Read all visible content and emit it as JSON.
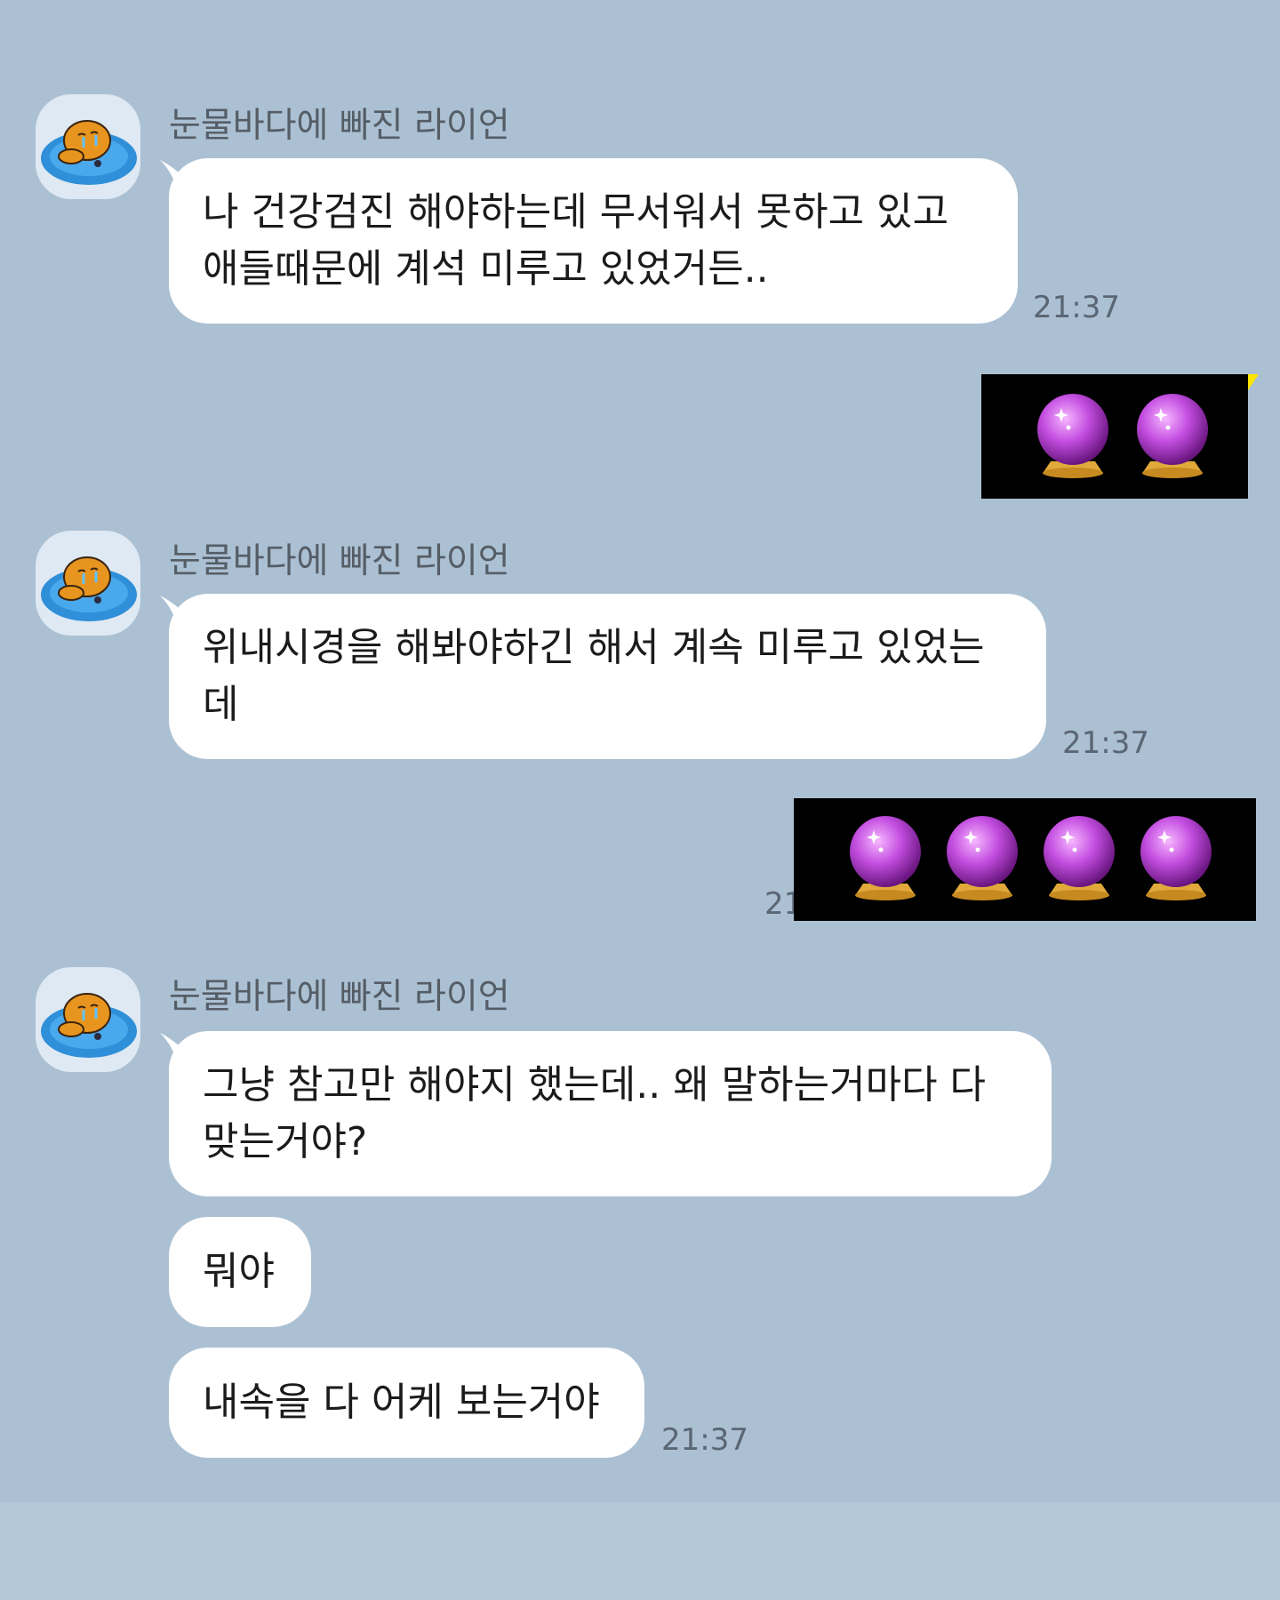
{
  "sender": {
    "name": "눈물바다에 빠진 라이언"
  },
  "messages": [
    {
      "text": "나 건강검진 해야하는데 무서워서 못하고 있고\n애들때문에 계석 미루고 있었거든..",
      "time": "21:37"
    },
    {
      "text": "위내시경을 해봐야하긴 해서 계속 미루고 있었는\n데",
      "time": "21:37"
    },
    {
      "text": "그냥 참고만 해야지 했는데.. 왜 말하는거마다 다\n맞는거야?"
    },
    {
      "text": "뭐야"
    },
    {
      "text": "내속을 다 어케 보는거야",
      "time": "21:37"
    }
  ],
  "sent_emoticons": [
    {
      "icon": "crystal-ball-icon",
      "count": 2
    },
    {
      "icon": "crystal-ball-icon",
      "count": 4,
      "time_partial": "21"
    }
  ],
  "colors": {
    "background": "#abc0d3",
    "bubble": "#ffffff",
    "my_bubble_accent": "#fee500",
    "orb": "#b23ad0"
  }
}
